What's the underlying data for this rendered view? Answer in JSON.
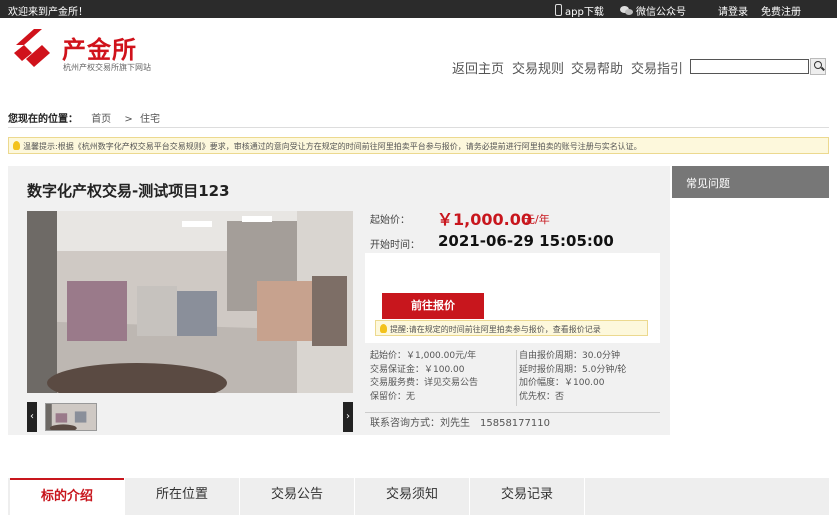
{
  "topbar": {
    "welcome": "欢迎来到产金所！",
    "app_download": "app下载",
    "wechat": "微信公众号",
    "login": "请登录",
    "register": "免费注册"
  },
  "header": {
    "brand": "产金所",
    "brand_sub": "杭州产权交易所旗下网站",
    "nav": [
      "返回主页",
      "交易规则",
      "交易帮助",
      "交易指引"
    ],
    "search_placeholder": ""
  },
  "breadcrumb": {
    "label": "您现在的位置：",
    "home": "首页",
    "sep": ">",
    "current": "住宅"
  },
  "notice": "温馨提示:根据《杭州数字化产权交易平台交易规则》要求，审核通过的意向受让方在规定的时间前往阿里拍卖平台参与报价，请务必提前进行阿里拍卖的账号注册与实名认证。",
  "project": {
    "title": "数字化产权交易-测试项目123",
    "start_price_label": "起始价：",
    "start_price": "￥1,000.00",
    "start_price_unit": "元/年",
    "start_time_label": "开始时间：",
    "start_time": "2021-06-29 15:05:00",
    "bid_button": "前往报价",
    "bid_tip": "提醒:请在规定的时间前往阿里拍卖参与报价，查看报价记录",
    "details_left": [
      "起始价：￥1,000.00元/年",
      "交易保证金：￥100.00",
      "交易服务费：详见交易公告",
      "保留价：无"
    ],
    "details_right": [
      "自由报价周期：30.0分钟",
      "延时报价周期：5.0分钟/轮",
      "加价幅度：￥100.00",
      "优先权：否"
    ],
    "contact": "联系咨询方式：刘先生　15858177110"
  },
  "sidebar": {
    "faq": "常见问题"
  },
  "tabs": [
    "标的介绍",
    "所在位置",
    "交易公告",
    "交易须知",
    "交易记录"
  ],
  "colors": {
    "accent": "#c8161d",
    "topbar": "#2b2b2b"
  }
}
